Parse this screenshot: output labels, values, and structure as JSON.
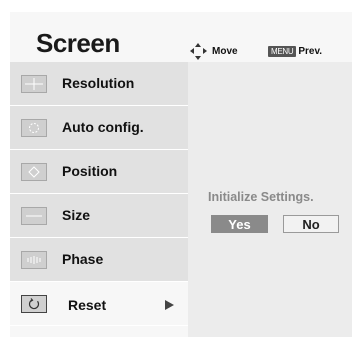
{
  "header": {
    "title": "Screen",
    "move_label": "Move",
    "menu_key": "MENU",
    "prev_label": "Prev."
  },
  "sidebar": {
    "items": [
      {
        "label": "Resolution",
        "icon": "resolution-icon"
      },
      {
        "label": "Auto config.",
        "icon": "auto-config-icon"
      },
      {
        "label": "Position",
        "icon": "position-icon"
      },
      {
        "label": "Size",
        "icon": "size-icon"
      },
      {
        "label": "Phase",
        "icon": "phase-icon"
      },
      {
        "label": "Reset",
        "icon": "reset-icon",
        "selected": true
      }
    ]
  },
  "panel": {
    "prompt": "Initialize Settings.",
    "yes_label": "Yes",
    "no_label": "No"
  },
  "colors": {
    "background": "#f7f7f7",
    "item_background": "#e1e1e1",
    "yes_button": "#8a8a8a",
    "prompt_text": "#8a8a8a"
  }
}
